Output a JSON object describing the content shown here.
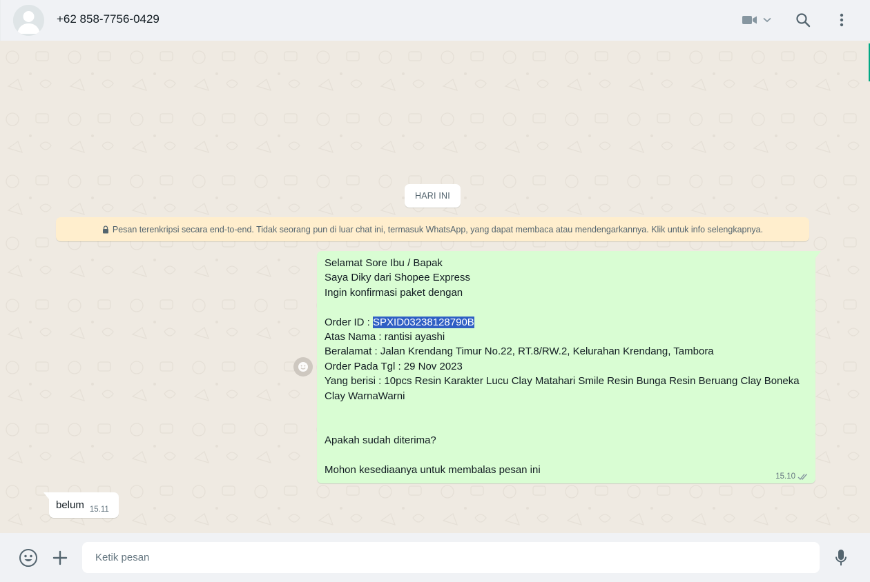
{
  "header": {
    "contact_name": "+62 858-7756-0429",
    "icons": [
      "avatar",
      "video-call-icon",
      "chevron-down-icon",
      "search-icon",
      "menu-icon"
    ]
  },
  "chat": {
    "date_chip": "HARI INI",
    "encryption_notice": "Pesan terenkripsi secara end-to-end. Tidak seorang pun di luar chat ini, termasuk WhatsApp, yang dapat membaca atau mendengarkannya. Klik untuk info selengkapnya.",
    "outgoing": {
      "lines_before": "Selamat Sore Ibu / Bapak\nSaya Diky dari Shopee Express\nIngin konfirmasi paket dengan\n\n",
      "order_label": "Order ID : ",
      "order_id": "SPXID03238128790B",
      "lines_after": "\nAtas Nama : rantisi ayashi\nBeralamat : Jalan Krendang Timur No.22, RT.8/RW.2, Kelurahan Krendang, Tambora\nOrder Pada Tgl : 29 Nov 2023\nYang berisi : 10pcs Resin Karakter Lucu Clay Matahari Smile Resin Bunga Resin Beruang Clay Boneka Clay WarnaWarni\n\n\nApakah sudah diterima?\n\nMohon kesediaanya untuk membalas pesan ini",
      "time": "15.10",
      "status": "read"
    },
    "incoming": {
      "text": "belum",
      "time": "15.11"
    }
  },
  "footer": {
    "input_placeholder": "Ketik pesan",
    "input_value": ""
  },
  "colors": {
    "accent": "#00a884",
    "outgoing_bubble": "#d9fdd3",
    "incoming_bubble": "#ffffff",
    "notice_bg": "#ffeecd",
    "selection": "#2f5fc4",
    "chat_bg": "#efeae2"
  }
}
